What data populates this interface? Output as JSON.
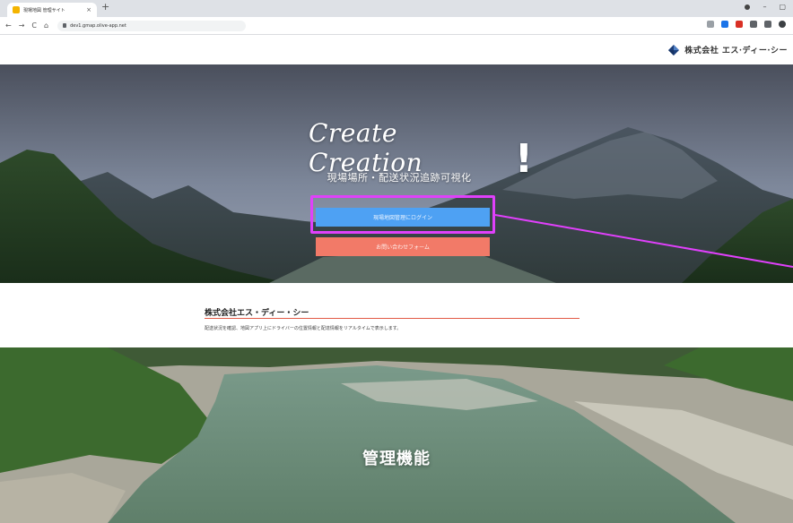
{
  "browser": {
    "tab_title": "現場地図 管理サイト",
    "tab_close": "×",
    "new_tab": "+",
    "url": "dev1.gmap.olive-app.net",
    "back": "←",
    "forward": "→",
    "reload": "C",
    "home": "⌂",
    "minimize": "–",
    "maximize": "▢"
  },
  "header": {
    "brand_name": "株式会社 エス·ディー·シー"
  },
  "hero": {
    "title_script": "Create Creation",
    "title_bang": "!",
    "subtitle": "現場場所・配送状況追跡可視化",
    "login_button": "現場地図管理にログイン",
    "contact_button": "お問い合わせフォーム"
  },
  "company": {
    "title": "株式会社エス・ディー・シー",
    "description": "配送状況を確認、地図アプリ上にドライバーの位置情報と配達情報をリアルタイムで表示します。"
  },
  "features": {
    "title": "管理機能"
  },
  "colors": {
    "login_button": "#4ea1f3",
    "contact_button": "#f27a68",
    "highlight": "#e040fb",
    "rule": "#e25a45"
  },
  "icons": {
    "brand": "diamond-logo-icon",
    "secure": "lock-icon"
  }
}
